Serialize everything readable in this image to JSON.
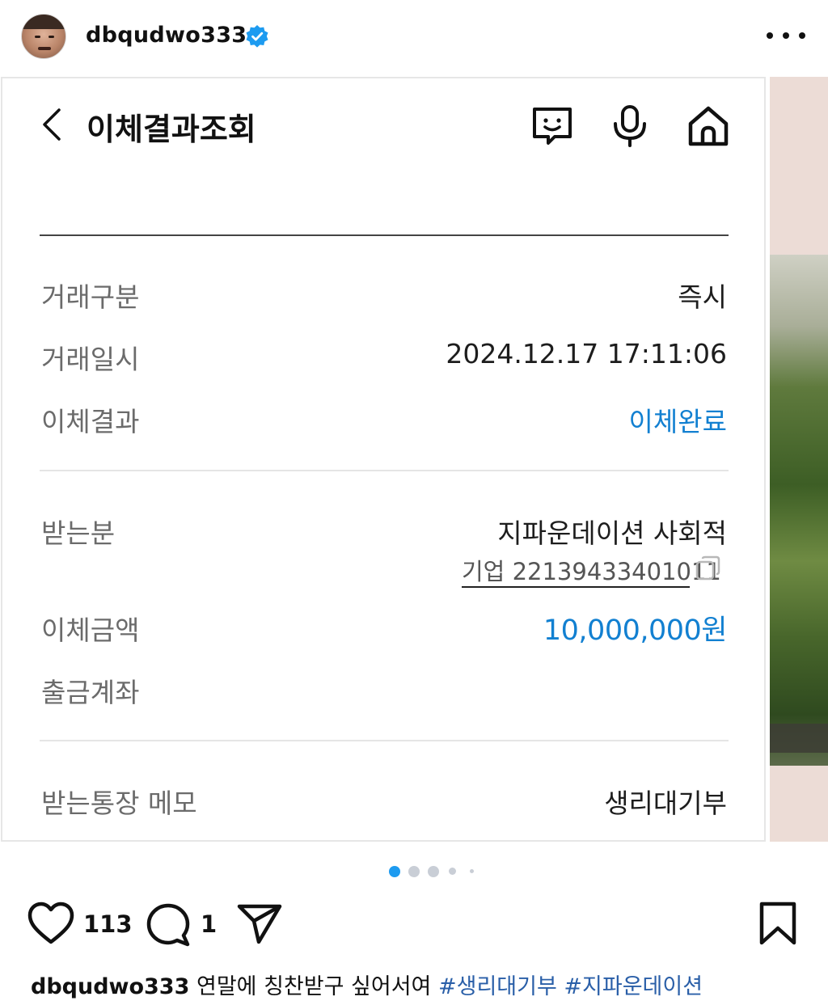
{
  "post": {
    "username": "dbqudwo333",
    "verified": true,
    "more_icon": "more-horizontal-icon"
  },
  "app": {
    "back_icon": "chevron-left-icon",
    "title": "이체결과조회",
    "header_icons": [
      "chatbot-icon",
      "microphone-icon",
      "home-icon"
    ]
  },
  "transfer": {
    "rows_top": [
      {
        "label": "거래구분",
        "value": "즉시"
      },
      {
        "label": "거래일시",
        "value": "2024.12.17 17:11:06"
      },
      {
        "label": "이체결과",
        "value": "이체완료"
      }
    ],
    "recipient_label": "받는분",
    "recipient_name": "지파운데이션 사회적",
    "recipient_account": "기업 22139433401011",
    "amount_label": "이체금액",
    "amount_value": "10,000,000원",
    "withdraw_label": "출금계좌",
    "withdraw_value": "",
    "memo_label": "받는통장 메모",
    "memo_value": "생리대기부"
  },
  "carousel": {
    "count": 5,
    "active_index": 0
  },
  "actions": {
    "likes": "113",
    "comments": "1"
  },
  "caption": {
    "username": "dbqudwo333",
    "text": "연말에 칭찬받구 싶어서여",
    "hashtags": [
      "#생리대기부",
      "#지파운데이션"
    ]
  },
  "colors": {
    "accent_blue": "#1280d1",
    "verified_blue": "#1d9bf0",
    "hashtag_blue": "#2a5fa8",
    "dot_active": "#1d9bf0",
    "dot_inactive": "#c9ced6"
  }
}
